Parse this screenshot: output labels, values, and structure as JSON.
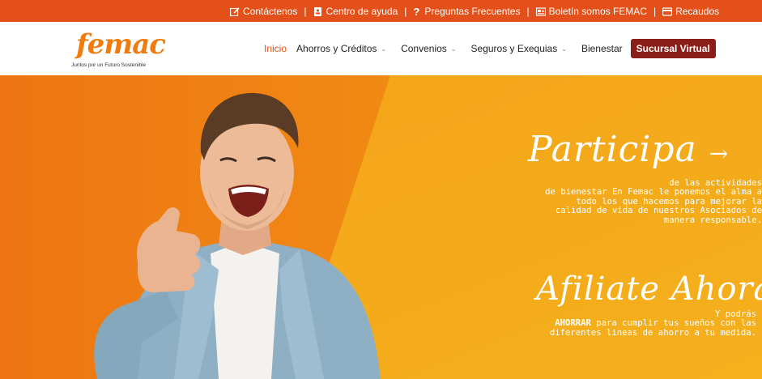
{
  "topbar": {
    "links": [
      {
        "label": "Contáctenos",
        "icon": "edit-icon"
      },
      {
        "label": "Centro de ayuda",
        "icon": "contact-book-icon"
      },
      {
        "label": "Preguntas Frecuentes",
        "icon": "question-icon"
      },
      {
        "label": "Boletín somos FEMAC",
        "icon": "newspaper-icon"
      },
      {
        "label": "Recaudos",
        "icon": "credit-card-icon"
      }
    ],
    "separator": "|"
  },
  "logo": {
    "name": "femac",
    "tagline": "Juntos por un Futuro Sostenible"
  },
  "nav": {
    "items": [
      {
        "label": "Inicio"
      },
      {
        "label": "Ahorros y Créditos"
      },
      {
        "label": "Convenios"
      },
      {
        "label": "Seguros y Exequias"
      },
      {
        "label": "Bienestar"
      }
    ],
    "button": "Sucursal Virtual"
  },
  "hero": {
    "cta1": {
      "title": "Participa",
      "arrow": "→",
      "lines": [
        "de las actividades",
        "de bienestar En Femac le ponemos el alma a",
        "todo los que hacemos para mejorar la",
        "calidad de vida de nuestros Asociados de",
        "manera responsable."
      ]
    },
    "cta2": {
      "title": "Afiliate Ahora",
      "arrow": "→",
      "line1": "Y podrás",
      "emphasis": "AHORRAR",
      "line2_rest": " para cumplir tus sueños con las",
      "line3": "diferentes lineas de ahorro a tu medida."
    }
  },
  "colors": {
    "topbar": "#e3501a",
    "accent": "#e3501a",
    "button": "#8b1e18",
    "hero_left": "#ef7d12",
    "hero_right": "#f3a418"
  }
}
